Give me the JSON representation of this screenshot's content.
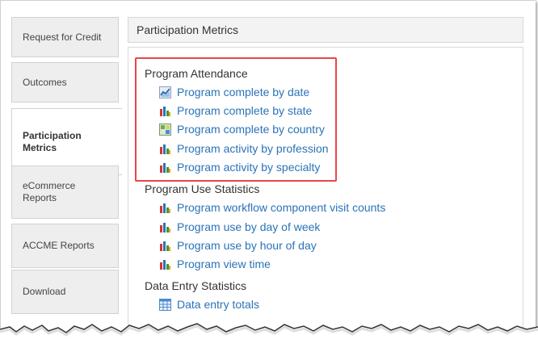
{
  "sidebar": {
    "items": [
      {
        "label": "Request for Credit",
        "active": false
      },
      {
        "label": "Outcomes",
        "active": false
      },
      {
        "label": "Participation Metrics",
        "active": true
      },
      {
        "label": "eCommerce Reports",
        "active": false
      },
      {
        "label": "ACCME Reports",
        "active": false
      },
      {
        "label": "Download",
        "active": false
      }
    ]
  },
  "header": {
    "title": "Participation Metrics"
  },
  "sections": [
    {
      "title": "Program Attendance",
      "links": [
        {
          "label": "Program complete by date",
          "icon": "line-chart-icon"
        },
        {
          "label": "Program complete by state",
          "icon": "bar-chart-icon"
        },
        {
          "label": "Program complete by country",
          "icon": "map-icon"
        },
        {
          "label": "Program activity by profession",
          "icon": "bar-chart-icon"
        },
        {
          "label": "Program activity by specialty",
          "icon": "bar-chart-icon"
        }
      ]
    },
    {
      "title": "Program Use Statistics",
      "links": [
        {
          "label": "Program workflow component visit counts",
          "icon": "bar-chart-icon"
        },
        {
          "label": "Program use by day of week",
          "icon": "bar-chart-icon"
        },
        {
          "label": "Program use by hour of day",
          "icon": "bar-chart-icon"
        },
        {
          "label": "Program view time",
          "icon": "bar-chart-icon"
        }
      ]
    },
    {
      "title": "Data Entry Statistics",
      "links": [
        {
          "label": "Data entry totals",
          "icon": "table-icon"
        }
      ]
    }
  ],
  "colors": {
    "link": "#2b73b7",
    "highlight": "#e8464a",
    "tab_bg": "#eeeeee"
  }
}
